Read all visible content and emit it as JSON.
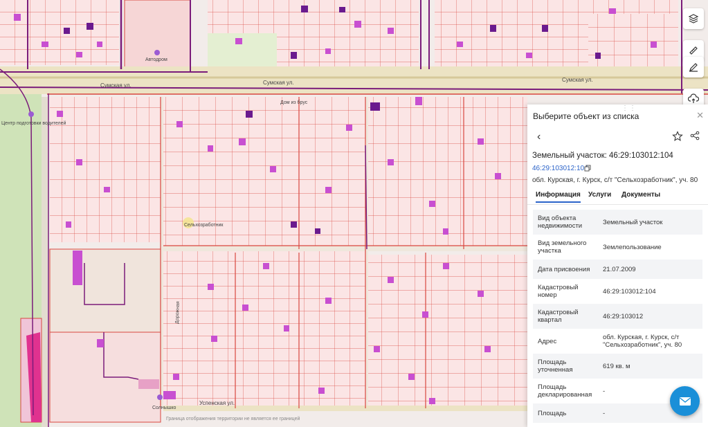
{
  "map": {
    "streets": [
      "Сумская ул.",
      "Сумская ул.",
      "Сумская ул.",
      "Успенская ул."
    ],
    "pois": [
      "Автодром",
      "Центр подготовки водителей",
      "Сельхозработник",
      "Дом из брус",
      "Дорожная",
      "Солнышко"
    ],
    "colors": {
      "parcel_fill": "#fbe5e5",
      "parcel_line": "#d9463f",
      "road": "#e9dcb6",
      "boundary": "#7a1b7a",
      "building": "#c84fd1",
      "building_dark": "#6a1a8e",
      "green": "#cfe3b8"
    }
  },
  "toolbar": {
    "icons": [
      "layers-icon",
      "ruler-icon",
      "edit-icon",
      "upload-icon"
    ]
  },
  "panel": {
    "header_title": "Выберите объект из списка",
    "object_title": "Земельный участок: 46:29:103012:104",
    "cadastral_link": "46:29:103012:104",
    "address_line": "обл. Курская, г. Курск, с/т \"Сельхозработник\", уч. 80",
    "tabs": [
      "Информация",
      "Услуги",
      "Документы"
    ],
    "rows": [
      {
        "label": "Вид объекта недвижимости",
        "value": "Земельный участок"
      },
      {
        "label": "Вид земельного участка",
        "value": "Землепользование"
      },
      {
        "label": "Дата присвоения",
        "value": "21.07.2009"
      },
      {
        "label": "Кадастровый номер",
        "value": "46:29:103012:104"
      },
      {
        "label": "Кадастровый квартал",
        "value": "46:29:103012"
      },
      {
        "label": "Адрес",
        "value": "обл. Курская, г. Курск, с/т \"Сельхозработник\", уч. 80"
      },
      {
        "label": "Площадь уточненная",
        "value": "619 кв. м"
      },
      {
        "label": "Площадь декларированная",
        "value": "-"
      },
      {
        "label": "Площадь",
        "value": "-"
      }
    ]
  },
  "bottom_note": "Граница отображения территории не является ее границей"
}
